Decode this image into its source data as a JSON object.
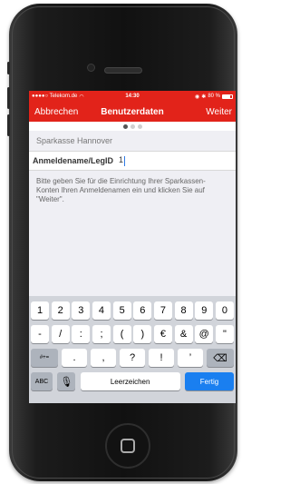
{
  "statusbar": {
    "carrier": "●●●●○ Telekom.de",
    "time": "14:30",
    "battery": "80 %",
    "battery_level": 0.8
  },
  "navbar": {
    "cancel": "Abbrechen",
    "title": "Benutzerdaten",
    "next": "Weiter"
  },
  "pager": {
    "count": 3,
    "active": 1
  },
  "bank": "Sparkasse Hannover",
  "login": {
    "label": "Anmeldename/LegID",
    "value": "1"
  },
  "hint": "Bitte geben Sie für die Einrichtung Ihrer Sparkassen-Konten Ihren Anmeldenamen ein und klicken Sie auf \"Weiter\".",
  "keyboard": {
    "row1": [
      "1",
      "2",
      "3",
      "4",
      "5",
      "6",
      "7",
      "8",
      "9",
      "0"
    ],
    "row2": [
      "-",
      "/",
      ":",
      ";",
      "(",
      ")",
      "€",
      "&",
      "@",
      "\""
    ],
    "row3_shift": "#+=",
    "row3": [
      ".",
      ",",
      "?",
      "!",
      "’"
    ],
    "row3_delete": "⌫",
    "row4_abc": "ABC",
    "row4_mic": "🎙",
    "row4_space": "Leerzeichen",
    "row4_done": "Fertig"
  },
  "colors": {
    "brand": "#e2231a",
    "done_key": "#1a7ff0"
  }
}
